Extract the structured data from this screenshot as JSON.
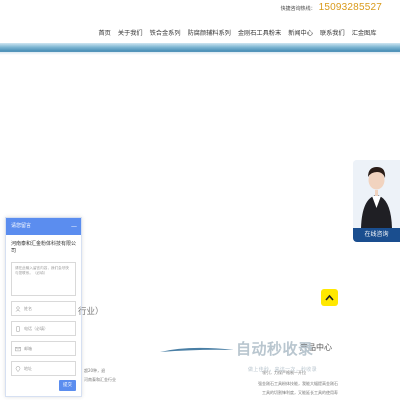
{
  "header": {
    "hotline_label": "快捷咨询热线：",
    "hotline_phone": "15093285527"
  },
  "nav": {
    "items": [
      {
        "label": "首页"
      },
      {
        "label": "关于我们"
      },
      {
        "label": "铁合金系列"
      },
      {
        "label": "防腐颜辅料系列"
      },
      {
        "label": "金刚石工具粉末"
      },
      {
        "label": "新闻中心"
      },
      {
        "label": "联系我们"
      },
      {
        "label": "汇金图库"
      }
    ]
  },
  "service": {
    "button_label": "在线咨询"
  },
  "message_panel": {
    "title": "请您留言",
    "close_symbol": "—",
    "company": "河南泰和汇金粉体科技有限公司",
    "textarea_placeholder": "请在此输入留言内容，我们会尽快与您联系。（必填）",
    "fields": [
      {
        "placeholder": "姓名",
        "icon": "user-icon"
      },
      {
        "placeholder": "电话（必填）",
        "icon": "phone-icon"
      },
      {
        "placeholder": "邮箱",
        "icon": "mail-icon"
      },
      {
        "placeholder": "地址",
        "icon": "location-icon"
      }
    ],
    "submit_label": "提交"
  },
  "content": {
    "industry_fragment": "行业）",
    "text_fragment_1": "超20种，退",
    "text_fragment_2": "河南泰和汇金行业",
    "heading_fragment": "产品中心",
    "right_text_1": "领引，力保严格制一开拉",
    "right_text_2": "强金刚石工具粉体技能，我能大幅提高金刚石",
    "right_text_3": "工具的切割锋利度，又能延长工具的使用寿"
  },
  "watermark": {
    "text": "自动秒收录",
    "sub": "做上佳秒，来访一次，秒收录"
  },
  "colors": {
    "accent_blue": "#5b8def",
    "phone_orange": "#d99a1a",
    "service_blue": "#1a4e8f",
    "scroll_yellow": "#ffe800"
  }
}
